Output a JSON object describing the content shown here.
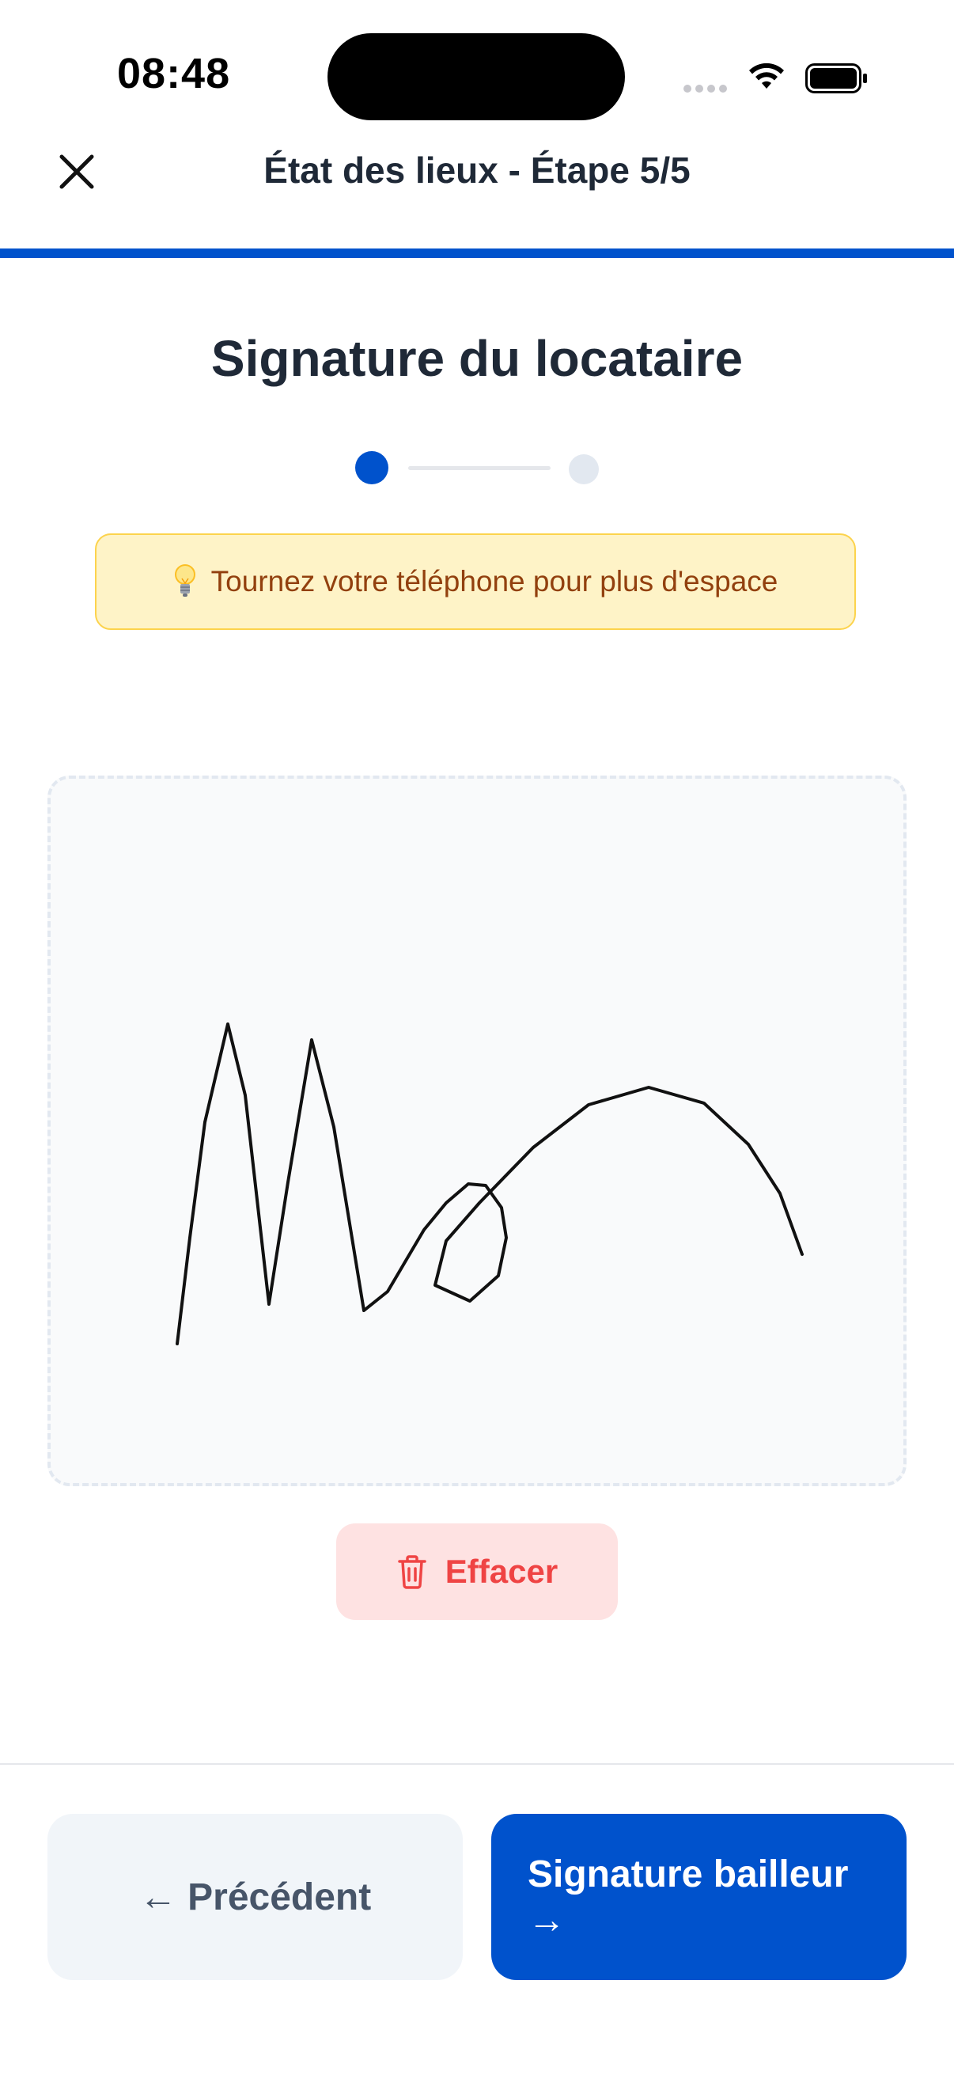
{
  "status_bar": {
    "time": "08:48",
    "icons": [
      "cellular-signal-icon",
      "wifi-icon",
      "battery-icon"
    ]
  },
  "header": {
    "close_icon": "close-icon",
    "title": "État des lieux - Étape 5/5",
    "progress_fraction": 1.0,
    "progress_color": "#0052cc"
  },
  "main": {
    "title": "Signature du locataire",
    "stepper": {
      "current_step": 1,
      "total_steps": 2,
      "active_color": "#0052cc",
      "inactive_color": "#e2e8f0"
    },
    "tip": {
      "icon": "lightbulb-icon",
      "text": "Tournez votre téléphone pour plus d'espace"
    },
    "signature_pad": {
      "has_signature": true
    },
    "clear_button": {
      "icon": "trash-icon",
      "label": "Effacer"
    }
  },
  "footer": {
    "prev_button": {
      "label": "← Précédent"
    },
    "next_button": {
      "label": "Signature bailleur\n→"
    }
  },
  "colors": {
    "primary": "#0052cc",
    "danger": "#ef4444",
    "danger_bg": "#fee2e2",
    "tip_bg": "#fef3c7",
    "tip_text": "#92400e"
  }
}
